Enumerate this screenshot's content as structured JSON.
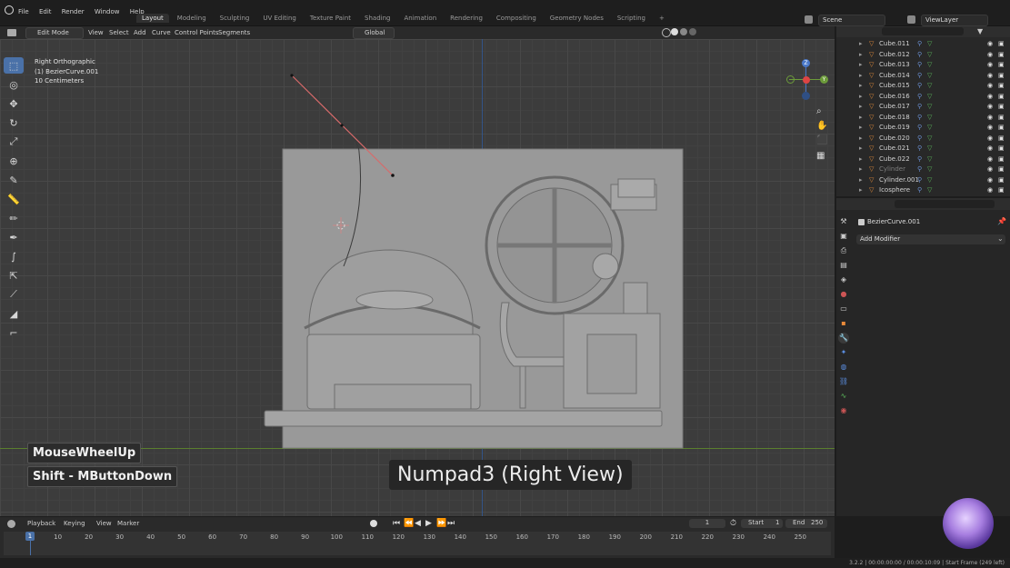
{
  "menu": [
    "File",
    "Edit",
    "Render",
    "Window",
    "Help"
  ],
  "workspaces": [
    "Layout",
    "Modeling",
    "Sculpting",
    "UV Editing",
    "Texture Paint",
    "Shading",
    "Animation",
    "Rendering",
    "Compositing",
    "Geometry Nodes",
    "Scripting"
  ],
  "add_workspace": "+",
  "scene": "Scene",
  "view_layer": "ViewLayer",
  "viewport_header": {
    "mode": "Edit Mode",
    "items": [
      "View",
      "Select",
      "Add",
      "Curve",
      "Control Points",
      "Segments"
    ],
    "orientation": "Global"
  },
  "overlay": {
    "view": "Right Orthographic",
    "object": "(1) BezierCurve.001",
    "scale": "10 Centimeters"
  },
  "gizmo": {
    "z": "Z",
    "y": "Y"
  },
  "keycasts": [
    "MouseWheelUp",
    "Shift - MButtonDown"
  ],
  "big_keycast": "Numpad3 (Right View)",
  "outliner": {
    "rows": [
      {
        "name": "Cube.011",
        "dim": false
      },
      {
        "name": "Cube.012",
        "dim": false
      },
      {
        "name": "Cube.013",
        "dim": false
      },
      {
        "name": "Cube.014",
        "dim": false
      },
      {
        "name": "Cube.015",
        "dim": false
      },
      {
        "name": "Cube.016",
        "dim": false
      },
      {
        "name": "Cube.017",
        "dim": false
      },
      {
        "name": "Cube.018",
        "dim": false
      },
      {
        "name": "Cube.019",
        "dim": false
      },
      {
        "name": "Cube.020",
        "dim": false
      },
      {
        "name": "Cube.021",
        "dim": false
      },
      {
        "name": "Cube.022",
        "dim": false
      },
      {
        "name": "Cylinder",
        "dim": true
      },
      {
        "name": "Cylinder.001",
        "dim": false
      },
      {
        "name": "Icosphere",
        "dim": false
      }
    ]
  },
  "properties": {
    "object_name": "BezierCurve.001",
    "add_modifier": "Add Modifier"
  },
  "timeline": {
    "menus": [
      "Playback",
      "Keying",
      "View",
      "Marker"
    ],
    "current_frame": "1",
    "start_label": "Start",
    "start": "1",
    "end_label": "End",
    "end": "250",
    "ticks": [
      "1",
      "10",
      "20",
      "30",
      "40",
      "50",
      "60",
      "70",
      "80",
      "90",
      "100",
      "110",
      "120",
      "130",
      "140",
      "150",
      "160",
      "170",
      "180",
      "190",
      "200",
      "210",
      "220",
      "230",
      "240",
      "250"
    ]
  },
  "status": "3.2.2 | 00:00:00:00 / 00:00:10:09 | Start Frame (249 left)",
  "colors": {
    "accent": "#4a71a8",
    "selected_edge": "#d86a6a",
    "axis_y": "#6c9b3a",
    "axis_z": "#4a78c8"
  }
}
